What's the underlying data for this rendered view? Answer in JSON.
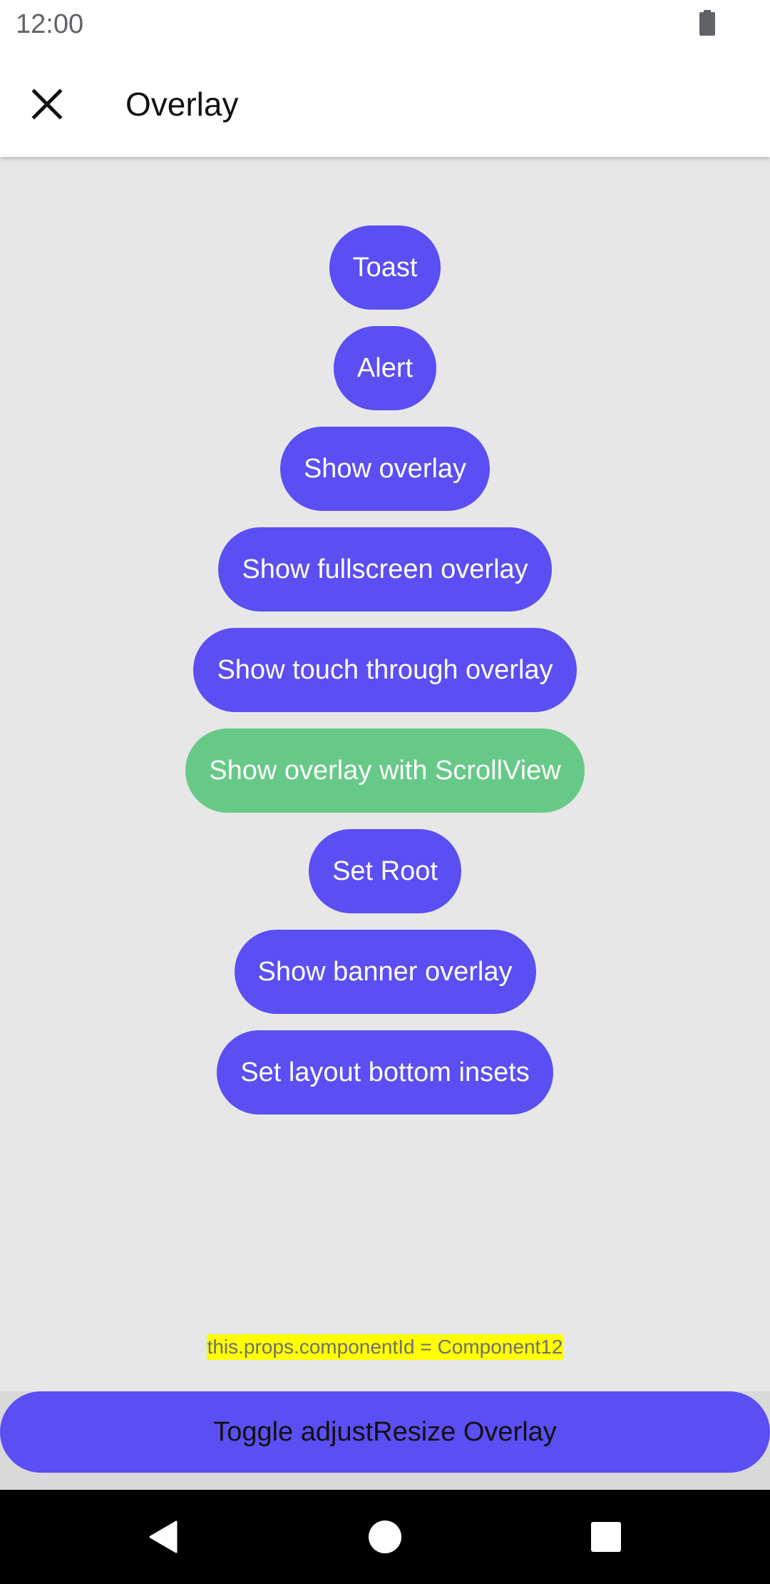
{
  "status_bar": {
    "time": "12:00",
    "battery_icon": "battery-icon"
  },
  "app_bar": {
    "close_icon": "close-icon",
    "title": "Overlay"
  },
  "buttons": [
    {
      "label": "Toast",
      "color": "#5b4ef2"
    },
    {
      "label": "Alert",
      "color": "#5b4ef2"
    },
    {
      "label": "Show overlay",
      "color": "#5b4ef2"
    },
    {
      "label": "Show fullscreen overlay",
      "color": "#5b4ef2"
    },
    {
      "label": "Show touch through overlay",
      "color": "#5b4ef2"
    },
    {
      "label": "Show overlay with ScrollView",
      "color": "#67c987"
    },
    {
      "label": "Set Root",
      "color": "#5b4ef2"
    },
    {
      "label": "Show banner overlay",
      "color": "#5b4ef2"
    },
    {
      "label": "Set layout bottom insets",
      "color": "#5b4ef2"
    }
  ],
  "component_id_text": "this.props.componentId = Component12",
  "toggle_button": {
    "label": "Toggle adjustResize Overlay"
  },
  "nav_bar": {
    "back_icon": "back-triangle-icon",
    "home_icon": "home-circle-icon",
    "recents_icon": "recents-square-icon"
  },
  "colors": {
    "accent": "#5b4ef2",
    "green": "#67c987",
    "background": "#e7e7e7",
    "highlight": "#ffff00"
  }
}
